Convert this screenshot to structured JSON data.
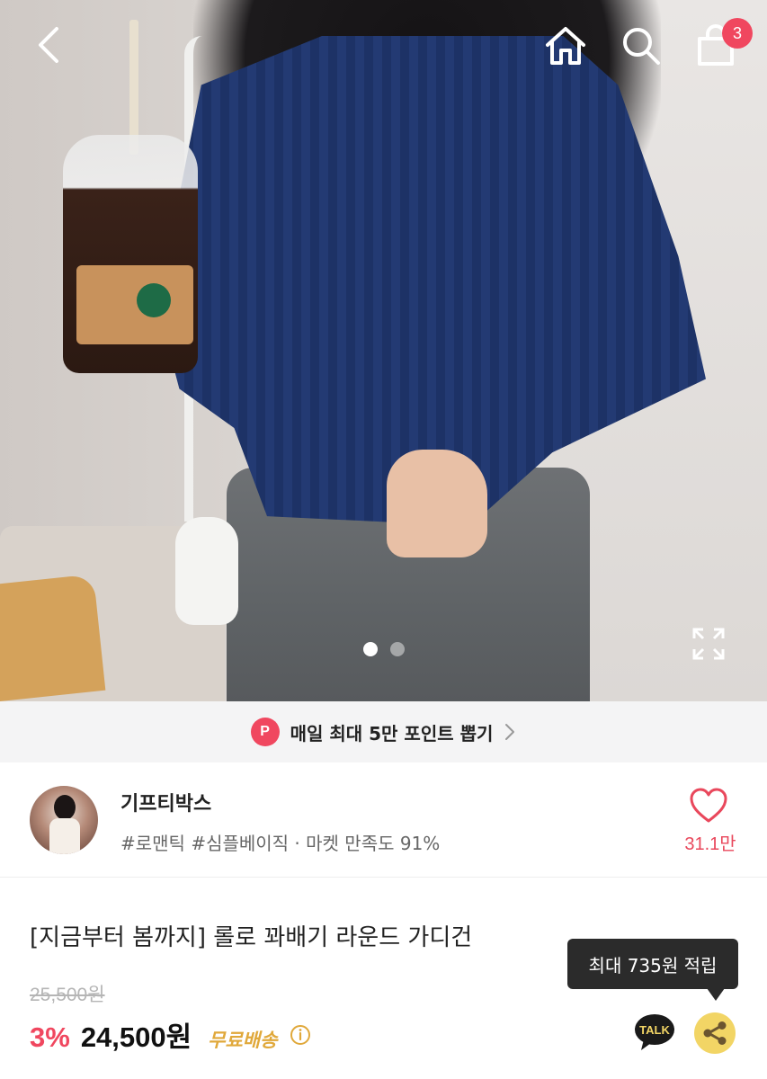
{
  "header": {
    "cart_count": "3"
  },
  "hero": {
    "image_alt": "product photo",
    "slides": 2,
    "active_slide": 1
  },
  "point_banner": {
    "badge": "P",
    "text": "매일 최대 5만 포인트 뽑기"
  },
  "shop": {
    "name": "기프티박스",
    "tags": "#로맨틱 #심플베이직 · 마켓 만족도 91%",
    "like_count": "31.1만"
  },
  "product": {
    "title": "[지금부터 봄까지] 롤로 꽈배기 라운드 가디건",
    "original_price": "25,500원",
    "discount": "3%",
    "sale_price": "24,500원",
    "free_shipping": "무료배송"
  },
  "tooltip": {
    "text": "최대 735원 적립"
  },
  "actions": {
    "talk_label": "TALK"
  },
  "colors": {
    "accent": "#f0475f",
    "free_shipping": "#e0a83a",
    "share_bg": "#f2d565",
    "tooltip_bg": "#2b2b2b"
  }
}
